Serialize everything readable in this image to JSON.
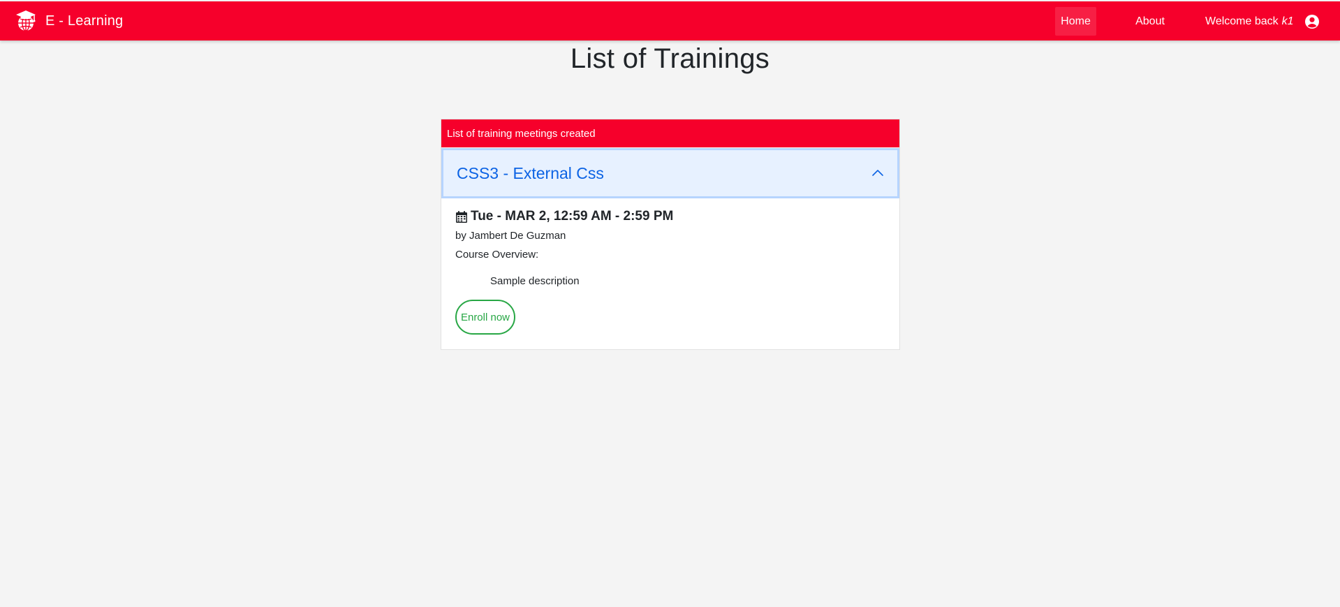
{
  "navbar": {
    "brand_text": "E - Learning",
    "brand_icon": "graduation-globe-icon",
    "links": {
      "home": "Home",
      "about": "About",
      "welcome_prefix": "Welcome back",
      "username": "k1"
    },
    "user_icon": "user-circle-icon",
    "colors": {
      "background": "#f6002b",
      "text": "#ffffff"
    }
  },
  "page": {
    "title": "List of Trainings"
  },
  "card": {
    "header": "List of training meetings created",
    "trainings": [
      {
        "title": "CSS3 - External Css",
        "expanded": true,
        "date_icon": "calendar-icon",
        "date": "Tue - MAR 2, 12:59 AM - 2:59 PM",
        "instructor": "by Jambert De Guzman",
        "overview_label": "Course Overview:",
        "description": "Sample description",
        "enroll_label": "Enroll now"
      }
    ]
  },
  "colors": {
    "accent": "#f6002b",
    "accordion_active_bg": "#e7f1ff",
    "accordion_title": "#0c63e4",
    "enroll": "#28a745",
    "page_bg": "#f4f4f4"
  }
}
